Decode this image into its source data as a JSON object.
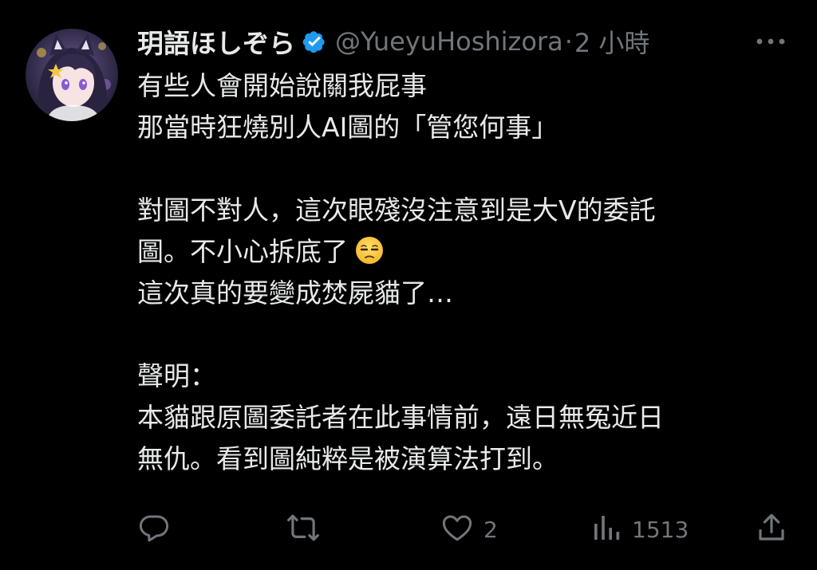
{
  "author": {
    "display_name": "玥語ほしぞら",
    "handle": "@YueyuHoshizora",
    "separator": "·",
    "time": "2 小時",
    "verified_icon": "verified-badge-icon",
    "colors": {
      "verified": "#1d9bf0"
    }
  },
  "tweet": {
    "lines": [
      "有些人會開始說關我屁事",
      "那當時狂燒別人AI圖的「管您何事」",
      "",
      "對圖不對人，這次眼殘沒注意到是大V的委託",
      "圖。不小心拆底了",
      "這次真的要變成焚屍貓了…",
      "",
      "聲明：",
      "本貓跟原圖委託者在此事情前，遠日無冤近日",
      "無仇。看到圖純粹是被演算法打到。"
    ],
    "emoji": "unamused-face"
  },
  "actions": {
    "reply": {
      "icon": "reply-icon",
      "count": ""
    },
    "repost": {
      "icon": "repost-icon",
      "count": ""
    },
    "like": {
      "icon": "heart-icon",
      "count": "2"
    },
    "views": {
      "icon": "views-chart-icon",
      "count": "1513"
    },
    "share": {
      "icon": "share-icon"
    }
  },
  "colors": {
    "background": "#000000",
    "text": "#e7e9ea",
    "secondary": "#71767b"
  }
}
